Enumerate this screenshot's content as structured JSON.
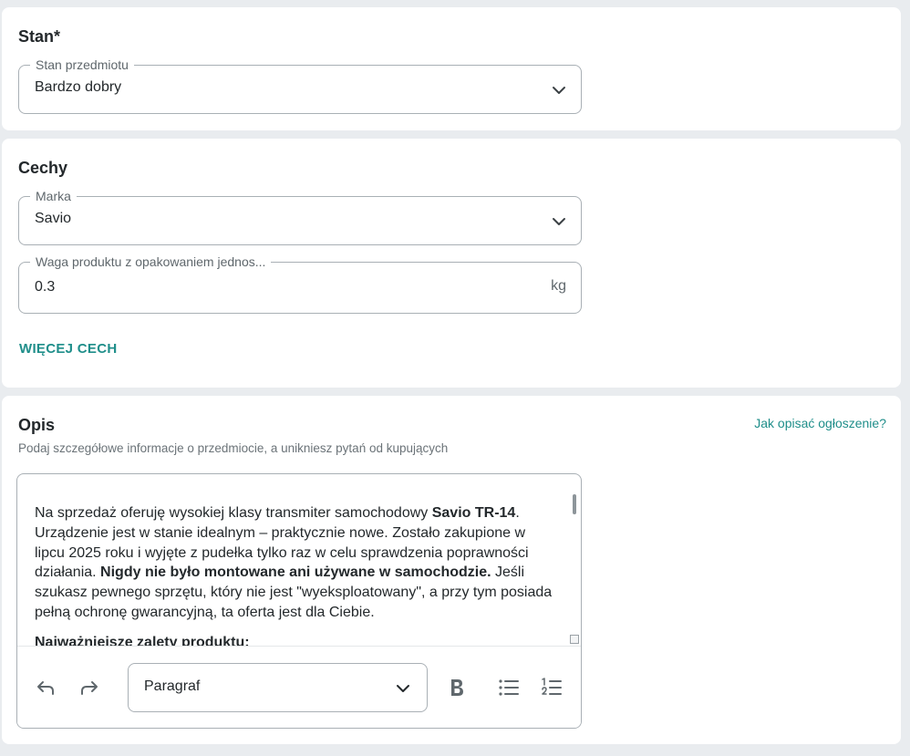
{
  "stan": {
    "title": "Stan*",
    "field_label": "Stan przedmiotu",
    "value": "Bardzo dobry"
  },
  "cechy": {
    "title": "Cechy",
    "marka_label": "Marka",
    "marka_value": "Savio",
    "waga_label": "Waga produktu z opakowaniem jednos...",
    "waga_value": "0.3",
    "waga_unit": "kg",
    "more_link": "WIĘCEJ CECH"
  },
  "opis": {
    "title": "Opis",
    "help_link": "Jak opisać ogłoszenie?",
    "hint": "Podaj szczegółowe informacje o przedmiocie, a unikniesz pytań od kupujących",
    "text_1": "Na sprzedaż oferuję wysokiej klasy transmiter samochodowy ",
    "text_bold_1": "Savio TR-14",
    "text_2": ". Urządzenie jest w stanie idealnym – praktycznie nowe. Zostało zakupione w lipcu 2025 roku i wyjęte z pudełka tylko raz w celu sprawdzenia poprawności działania. ",
    "text_bold_2": "Nigdy nie było montowane ani używane w samochodzie.",
    "text_3": " Jeśli szukasz pewnego sprzętu, który nie jest \"wyeksploatowany\", a przy tym posiada pełną ochronę gwarancyjną, ta oferta jest dla Ciebie.",
    "next_heading": "Najważniejsze zalety produktu:",
    "paragraph_select": "Paragraf"
  },
  "colors": {
    "accent": "#1f8e8a",
    "border": "#a9b0b5",
    "background": "#e9ecef"
  },
  "icons": [
    "chevron-down-icon",
    "undo-icon",
    "redo-icon",
    "bold-icon",
    "bullet-list-icon",
    "numbered-list-icon"
  ]
}
